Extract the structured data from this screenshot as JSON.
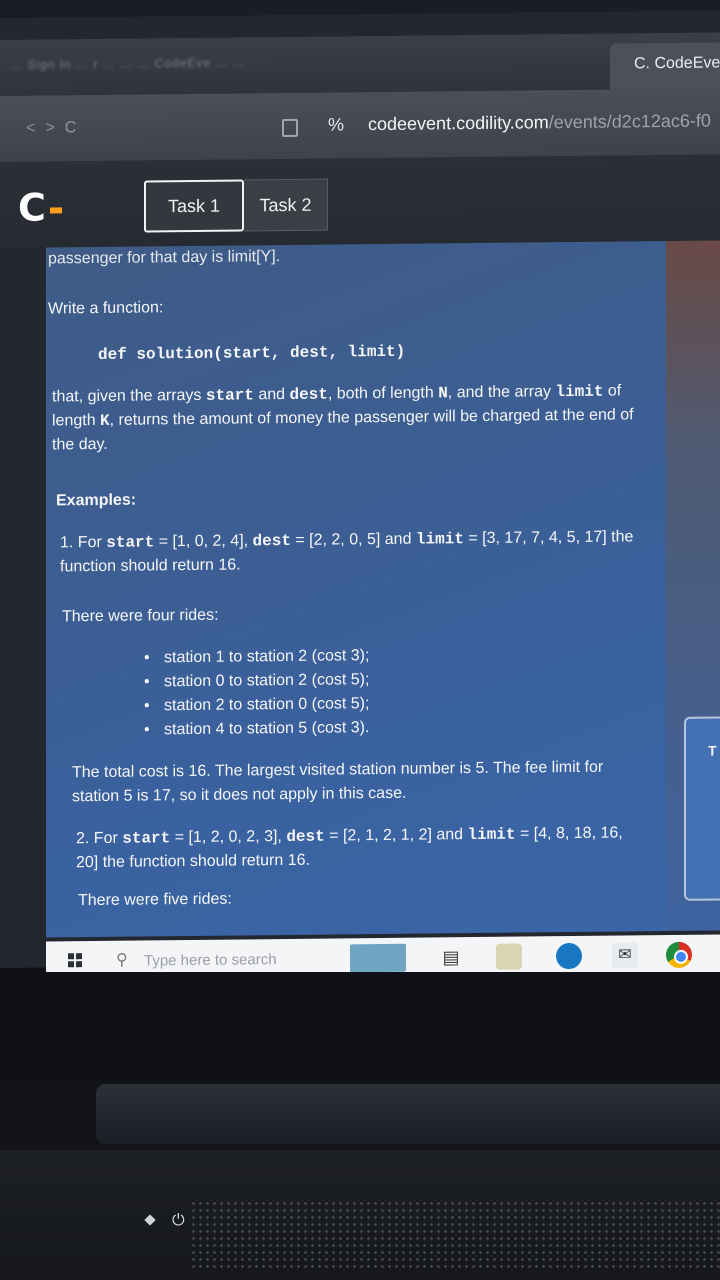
{
  "browser": {
    "other_tabs_text": "… Sign In … r … … … CodeEve … …",
    "active_tab_title": "C. CodeEve",
    "url_host": "codeevent.codility.com",
    "url_path": "/events/d2c12ac6-f0",
    "back": "<",
    "forward": ">",
    "reload": "C",
    "site_icon": "%"
  },
  "header": {
    "logo": "C",
    "tabs": [
      {
        "label": "Task 1"
      },
      {
        "label": "Task 2"
      }
    ]
  },
  "content": {
    "cut_line": "passenger for that day is limit[Y].",
    "write_function": "Write a function:",
    "signature": "def solution(start, dest, limit)",
    "desc": {
      "p1": "that, given the arrays ",
      "start": "start",
      "p2": " and ",
      "dest": "dest",
      "p3": ", both of length ",
      "N": "N",
      "p4": ", and the array ",
      "limit": "limit",
      "p5": " of length ",
      "K": "K",
      "p6": ", returns the amount of money the passenger will be charged at the end of the day."
    },
    "examples_heading": "Examples:",
    "ex1": {
      "prefix": "1. For ",
      "start_kw": "start",
      "start_val": " = [1, 0, 2, 4], ",
      "dest_kw": "dest",
      "dest_val": " = [2, 2, 0, 5] and ",
      "limit_kw": "limit",
      "limit_val": " = [3, 17, 7, 4, 5, 17] the function should return 16.",
      "rides_intro": "There were four rides:",
      "rides": [
        "station 1 to station 2 (cost 3);",
        "station 0 to station 2 (cost 5);",
        "station 2 to station 0 (cost 5);",
        "station 4 to station 5 (cost 3)."
      ],
      "summary": "The total cost is 16. The largest visited station number is 5. The fee limit for station 5 is 17, so it does not apply in this case."
    },
    "ex2": {
      "prefix": "2. For ",
      "start_kw": "start",
      "start_val": " = [1, 2, 0, 2, 3], ",
      "dest_kw": "dest",
      "dest_val": " = [2, 1, 2, 1, 2] and ",
      "limit_kw": "limit",
      "limit_val": " = [4, 8, 18, 16, 20] the function should return 16.",
      "rides_intro": "There were five rides:"
    }
  },
  "right_panel": {
    "letter": "T"
  },
  "taskbar": {
    "search_placeholder": "Type here to search"
  }
}
